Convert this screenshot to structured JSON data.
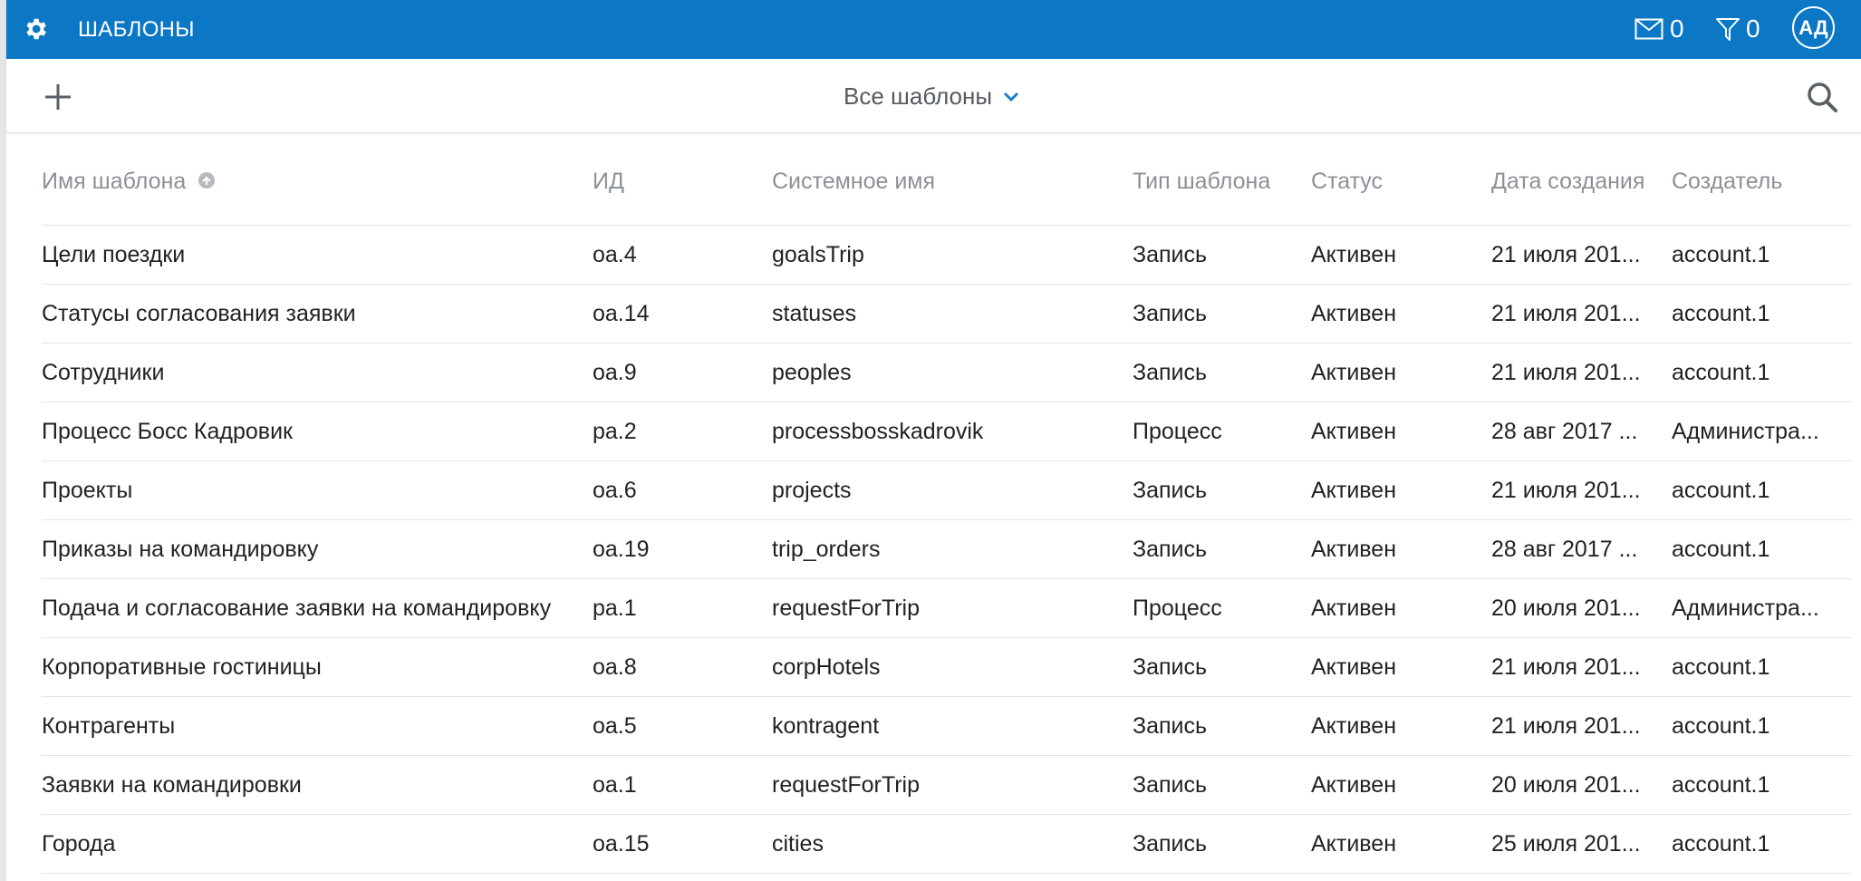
{
  "header": {
    "title": "ШАБЛОНЫ",
    "mail_count": "0",
    "filter_count": "0",
    "avatar_initials": "АД",
    "brand_color": "#0b77c5",
    "icons": [
      "gear-icon",
      "mail-icon",
      "filter-icon"
    ]
  },
  "toolbar": {
    "view_label": "Все шаблоны",
    "icons": [
      "plus-icon",
      "chevron-down-icon",
      "search-icon"
    ]
  },
  "table": {
    "columns": [
      "Имя шаблона",
      "ИД",
      "Системное имя",
      "Тип шаблона",
      "Статус",
      "Дата создания",
      "Создатель"
    ],
    "sort_icon": "sort-asc-icon",
    "rows": [
      [
        "Цели поездки",
        "oa.4",
        "goalsTrip",
        "Запись",
        "Активен",
        "21 июля 201...",
        "account.1"
      ],
      [
        "Статусы согласования заявки",
        "oa.14",
        "statuses",
        "Запись",
        "Активен",
        "21 июля 201...",
        "account.1"
      ],
      [
        "Сотрудники",
        "oa.9",
        "peoples",
        "Запись",
        "Активен",
        "21 июля 201...",
        "account.1"
      ],
      [
        "Процесс Босс Кадровик",
        "pa.2",
        "processbosskadrovik",
        "Процесс",
        "Активен",
        "28 авг 2017 ...",
        "Администра..."
      ],
      [
        "Проекты",
        "oa.6",
        "projects",
        "Запись",
        "Активен",
        "21 июля 201...",
        "account.1"
      ],
      [
        "Приказы на командировку",
        "oa.19",
        "trip_orders",
        "Запись",
        "Активен",
        "28 авг 2017 ...",
        "account.1"
      ],
      [
        "Подача и согласование заявки на командировку",
        "pa.1",
        "requestForTrip",
        "Процесс",
        "Активен",
        "20 июля 201...",
        "Администра..."
      ],
      [
        "Корпоративные гостиницы",
        "oa.8",
        "corpHotels",
        "Запись",
        "Активен",
        "21 июля 201...",
        "account.1"
      ],
      [
        "Контрагенты",
        "oa.5",
        "kontragent",
        "Запись",
        "Активен",
        "21 июля 201...",
        "account.1"
      ],
      [
        "Заявки на командировки",
        "oa.1",
        "requestForTrip",
        "Запись",
        "Активен",
        "20 июля 201...",
        "account.1"
      ],
      [
        "Города",
        "oa.15",
        "cities",
        "Запись",
        "Активен",
        "25 июля 201...",
        "account.1"
      ]
    ]
  }
}
